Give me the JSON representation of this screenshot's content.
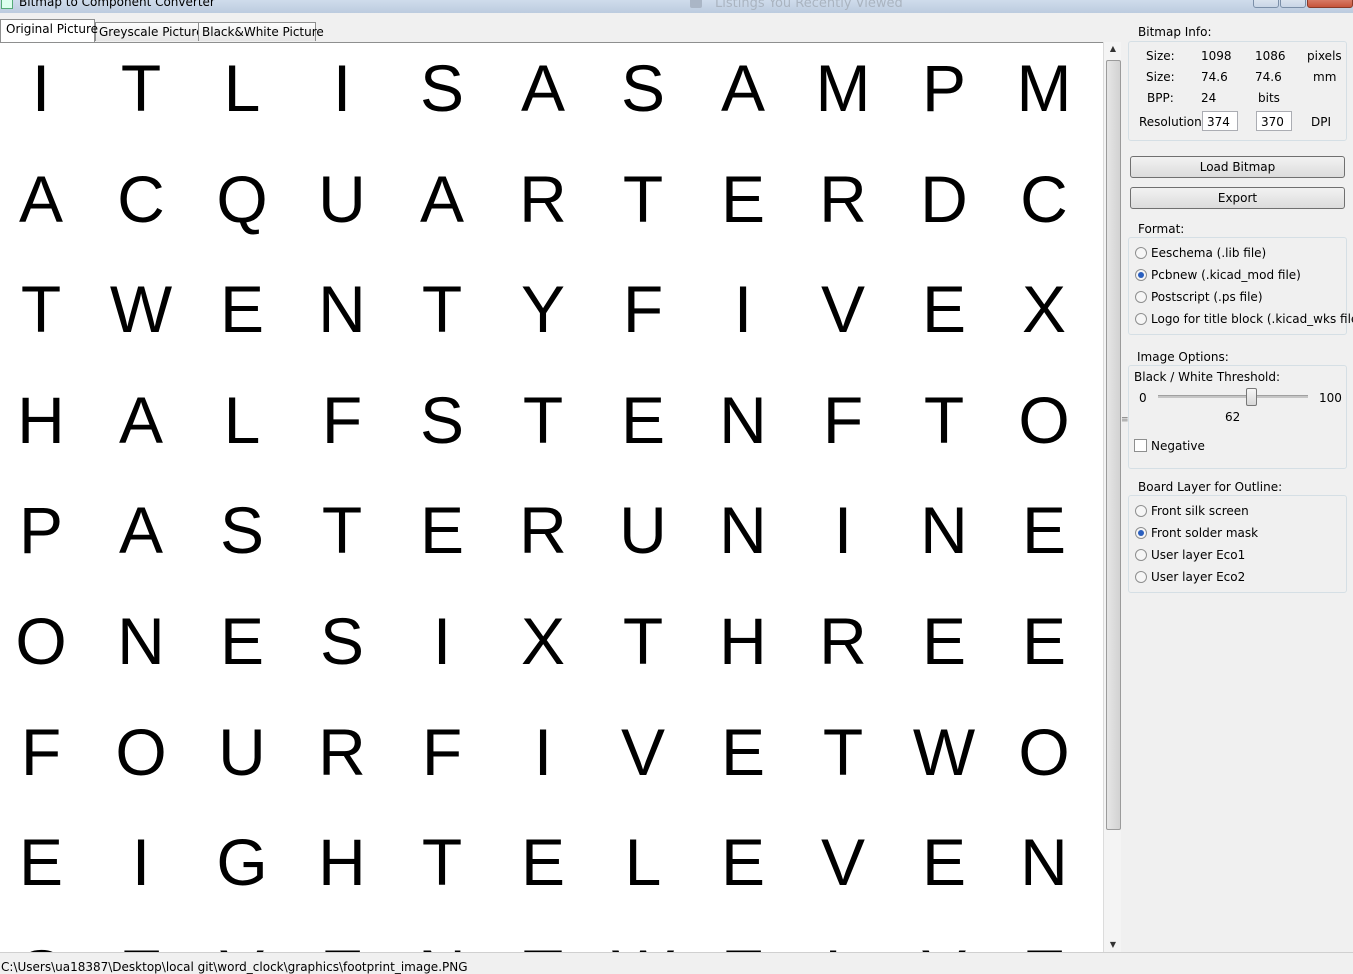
{
  "window": {
    "title": "Bitmap to Component Converter",
    "background_title": "Listings You Recently Viewed"
  },
  "tabs": [
    {
      "label": "Original Picture",
      "active": true
    },
    {
      "label": "Greyscale Picture",
      "active": false
    },
    {
      "label": "Black&White Picture",
      "active": false
    }
  ],
  "canvas": {
    "rows": [
      [
        "I",
        "T",
        "L",
        "I",
        "S",
        "A",
        "S",
        "A",
        "M",
        "P",
        "M"
      ],
      [
        "A",
        "C",
        "Q",
        "U",
        "A",
        "R",
        "T",
        "E",
        "R",
        "D",
        "C"
      ],
      [
        "T",
        "W",
        "E",
        "N",
        "T",
        "Y",
        "F",
        "I",
        "V",
        "E",
        "X"
      ],
      [
        "H",
        "A",
        "L",
        "F",
        "S",
        "T",
        "E",
        "N",
        "F",
        "T",
        "O"
      ],
      [
        "P",
        "A",
        "S",
        "T",
        "E",
        "R",
        "U",
        "N",
        "I",
        "N",
        "E"
      ],
      [
        "O",
        "N",
        "E",
        "S",
        "I",
        "X",
        "T",
        "H",
        "R",
        "E",
        "E"
      ],
      [
        "F",
        "O",
        "U",
        "R",
        "F",
        "I",
        "V",
        "E",
        "T",
        "W",
        "O"
      ],
      [
        "E",
        "I",
        "G",
        "H",
        "T",
        "E",
        "L",
        "E",
        "V",
        "E",
        "N"
      ],
      [
        "S",
        "E",
        "V",
        "E",
        "N",
        "T",
        "W",
        "E",
        "L",
        "V",
        "E"
      ]
    ]
  },
  "bitmap_info": {
    "group_label": "Bitmap Info:",
    "size_label": "Size:",
    "size_px_w": "1098",
    "size_px_h": "1086",
    "size_px_unit": "pixels",
    "size_mm_w": "74.6",
    "size_mm_h": "74.6",
    "size_mm_unit": "mm",
    "bpp_label": "BPP:",
    "bpp_value": "24",
    "bpp_unit": "bits",
    "resolution_label": "Resolution:",
    "resolution_x": "374",
    "resolution_y": "370",
    "resolution_unit": "DPI"
  },
  "buttons": {
    "load": "Load Bitmap",
    "export": "Export"
  },
  "format": {
    "group_label": "Format:",
    "options": [
      {
        "label": "Eeschema (.lib file)",
        "selected": false
      },
      {
        "label": "Pcbnew (.kicad_mod file)",
        "selected": true
      },
      {
        "label": "Postscript (.ps file)",
        "selected": false
      },
      {
        "label": "Logo for title block (.kicad_wks file)",
        "selected": false
      }
    ]
  },
  "image_options": {
    "group_label": "Image Options:",
    "threshold_label": "Black / White Threshold:",
    "min": "0",
    "max": "100",
    "value": "62",
    "negative_label": "Negative",
    "negative_checked": false
  },
  "board_layer": {
    "group_label": "Board Layer for Outline:",
    "options": [
      {
        "label": "Front silk screen",
        "selected": false
      },
      {
        "label": "Front solder mask",
        "selected": true
      },
      {
        "label": "User layer Eco1",
        "selected": false
      },
      {
        "label": "User layer Eco2",
        "selected": false
      }
    ]
  },
  "status": {
    "path": "C:\\Users\\ua18387\\Desktop\\local git\\word_clock\\graphics\\footprint_image.PNG"
  }
}
